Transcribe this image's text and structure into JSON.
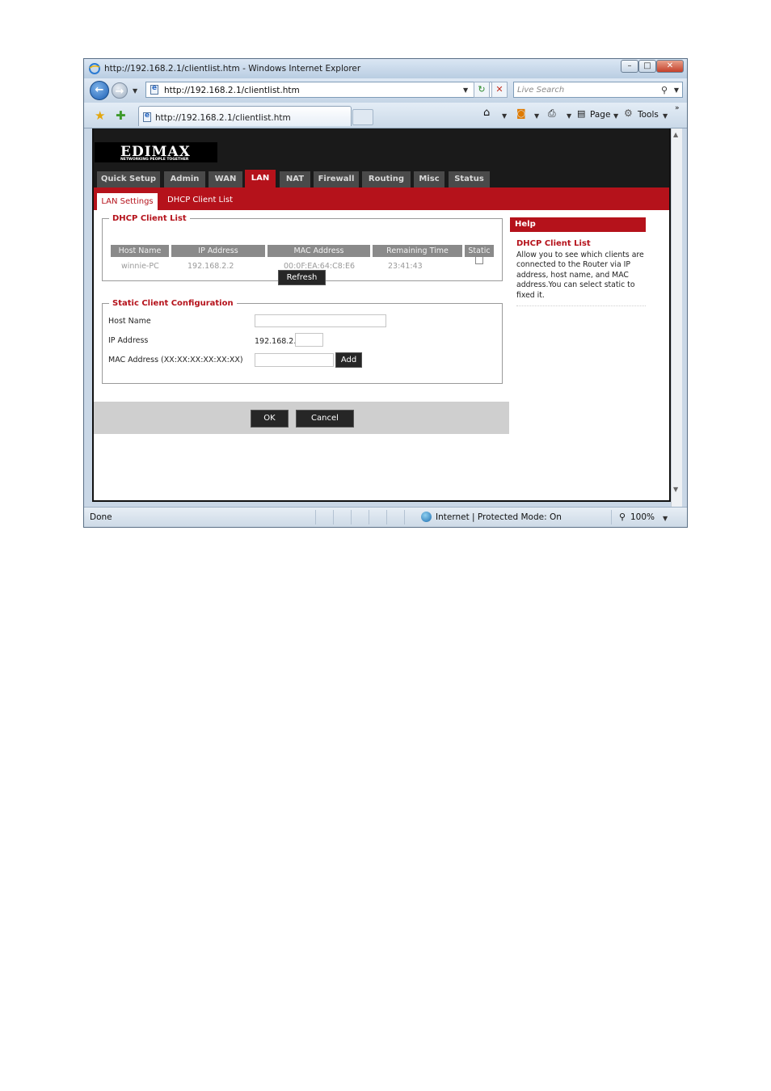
{
  "window": {
    "title": "http://192.168.2.1/clientlist.htm - Windows Internet Explorer",
    "minimize_icon": "minimize-icon",
    "maximize_icon": "maximize-icon",
    "close_icon": "close-icon"
  },
  "address_bar": {
    "url": "http://192.168.2.1/clientlist.htm",
    "search_placeholder": "Live Search"
  },
  "tab": {
    "label": "http://192.168.2.1/clientlist.htm"
  },
  "command_bar": {
    "page_label": "Page",
    "tools_label": "Tools"
  },
  "router": {
    "logo_name": "EDIMAX",
    "logo_tagline": "NETWORKING PEOPLE TOGETHER",
    "menu": [
      "Quick Setup",
      "Admin",
      "WAN",
      "LAN",
      "NAT",
      "Firewall",
      "Routing",
      "Misc",
      "Status"
    ],
    "active_menu": "LAN",
    "subtabs": [
      "LAN Settings",
      "DHCP Client List"
    ]
  },
  "dhcp_list": {
    "legend": "DHCP Client List",
    "columns": [
      "Host Name",
      "IP Address",
      "MAC Address",
      "Remaining Time",
      "Static"
    ],
    "rows": [
      {
        "host": "winnie-PC",
        "ip": "192.168.2.2",
        "mac": "00:0F:EA:64:C8:E6",
        "time": "23:41:43"
      }
    ],
    "refresh_label": "Refresh"
  },
  "static_config": {
    "legend": "Static Client Configuration",
    "host_label": "Host Name",
    "ip_label": "IP Address",
    "ip_prefix": "192.168.2.",
    "mac_label": "MAC Address (XX:XX:XX:XX:XX:XX)",
    "add_label": "Add"
  },
  "buttons": {
    "ok": "OK",
    "cancel": "Cancel"
  },
  "help": {
    "header": "Help",
    "title": "DHCP Client List",
    "body": "Allow you to see which clients are connected to the Router via IP address, host name, and MAC address.You can select static to fixed it."
  },
  "status_bar": {
    "status": "Done",
    "zone": "Internet | Protected Mode: On",
    "zoom": "100%"
  },
  "colors": {
    "brand_red": "#b5121b",
    "menu_gray": "#4a4a4a",
    "header_black": "#1a1a1a"
  }
}
